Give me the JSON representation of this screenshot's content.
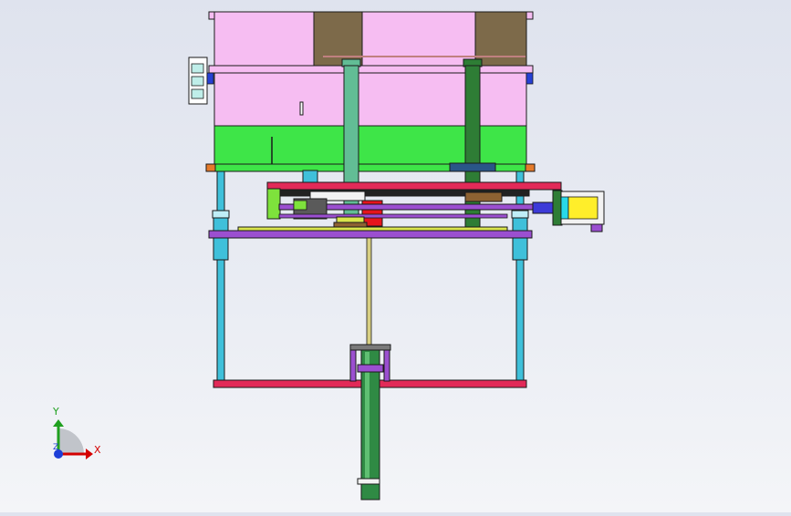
{
  "axes": {
    "x_label": "X",
    "y_label": "Y",
    "z_label": "Z",
    "colors": {
      "x": "#d40000",
      "y": "#1fa01f",
      "z": "#1e3fd8"
    }
  },
  "colors": {
    "mold_plate": "#f6bdf2",
    "mold_core": "#7d6a4a",
    "green_plate": "#3ee548",
    "pillar_light": "#62bd95",
    "pillar_dark": "#2e7d35",
    "guide_rod": "#3fc0da",
    "crossbar": "#9b4fd0",
    "beam_red": "#e22a58",
    "cylinder": "#2f8a44",
    "motor_yellow": "#ffee2a",
    "motor_cyan": "#29d9e8",
    "outline": "#1a1a1a"
  }
}
